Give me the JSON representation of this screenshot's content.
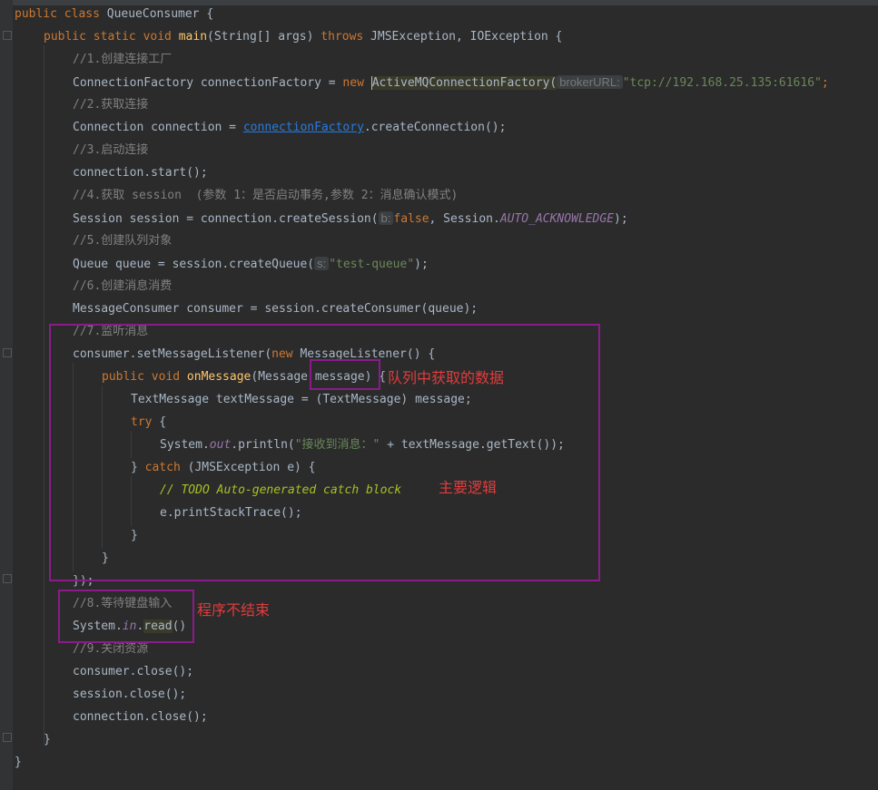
{
  "code": {
    "class_header": "public class QueueConsumer {",
    "main_sig_kw1": "public static void ",
    "main_name": "main",
    "main_sig_rest": "(String[] args) ",
    "throws_kw": "throws",
    "main_sig_end": " JMSException, IOException {",
    "c1": "//1.创建连接工厂",
    "l1a": "ConnectionFactory connectionFactory = ",
    "new_kw": "new",
    "l1b": "ActiveMQConnectionFactory(",
    "l1_hint": "brokerURL:",
    "l1_str": "\"tcp://192.168.25.135:61616\"",
    "l1_end": ";",
    "c2": "//2.获取连接",
    "l2a": "Connection connection = ",
    "l2_link": "connectionFactory",
    "l2b": ".createConnection();",
    "c3": "//3.启动连接",
    "l3": "connection.start();",
    "c4": "//4.获取 session  (参数 1：是否启动事务,参数 2：消息确认模式)",
    "l4a": "Session session = connection.createSession(",
    "l4_hint": "b:",
    "l4_false": "false",
    "l4b": ", Session.",
    "l4_fld": "AUTO_ACKNOWLEDGE",
    "l4c": ");",
    "c5": "//5.创建队列对象",
    "l5a": "Queue queue = session.createQueue(",
    "l5_hint": "s:",
    "l5_str": "\"test-queue\"",
    "l5b": ");",
    "c6": "//6.创建消息消费",
    "l6": "MessageConsumer consumer = session.createConsumer(queue);",
    "c7": "//7.监听消息",
    "l7a": "consumer.setMessageListener(",
    "l7b": " MessageListener() {",
    "l8a": "public void ",
    "l8_fn": "onMessage",
    "l8b": "(Message message) {",
    "l9": "TextMessage textMessage = (TextMessage) message;",
    "l10": "try",
    "l10b": " {",
    "l11a": "System.",
    "l11_fld": "out",
    "l11b": ".println(",
    "l11_str": "\"接收到消息：\"",
    "l11c": " + textMessage.getText());",
    "l12a": "} ",
    "l12_catch": "catch",
    "l12b": " (JMSException e) {",
    "l13": "// TODO Auto-generated catch block",
    "l14": "e.printStackTrace();",
    "l15": "}",
    "l16": "}",
    "l17": "});",
    "c8": "//8.等待键盘输入",
    "l18a": "System.",
    "l18_fld": "in",
    "l18b": ".",
    "l18_read": "read",
    "l18c": "()",
    "c9": "//9.关闭资源",
    "l19": "consumer.close();",
    "l20": "session.close();",
    "l21": "connection.close();",
    "l22": "}",
    "l23": "}"
  },
  "annotations": {
    "message_note": "队列中获取的数据",
    "main_logic_note": "主要逻辑",
    "no_exit_note": "程序不结束"
  }
}
